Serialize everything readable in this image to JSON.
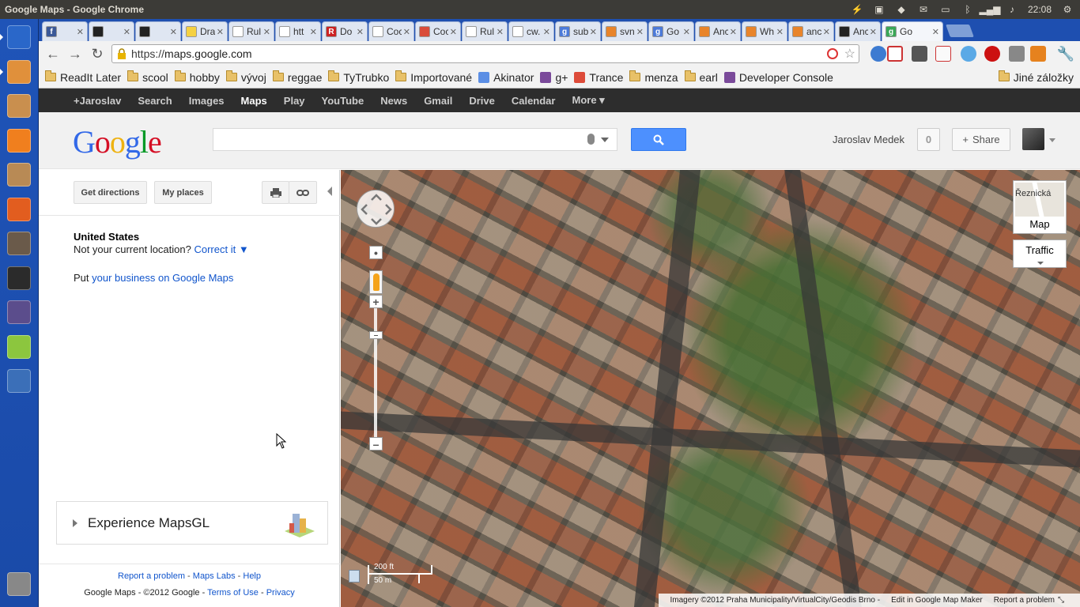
{
  "window": {
    "title": "Google Maps - Google Chrome",
    "clock": "22:08"
  },
  "tabs": [
    {
      "label": "",
      "color": "#3b5998",
      "glyph": "f"
    },
    {
      "label": "",
      "color": "#222222",
      "glyph": ""
    },
    {
      "label": "",
      "color": "#222222",
      "glyph": ""
    },
    {
      "label": "Dra",
      "color": "#f5d142",
      "glyph": ""
    },
    {
      "label": "Rul",
      "color": "#ffffff",
      "glyph": ""
    },
    {
      "label": "htt",
      "color": "#ffffff",
      "glyph": ""
    },
    {
      "label": "Do",
      "color": "#cc2222",
      "glyph": "R"
    },
    {
      "label": "Coc",
      "color": "#ffffff",
      "glyph": ""
    },
    {
      "label": "Coc",
      "color": "#d94c3a",
      "glyph": ""
    },
    {
      "label": "Rul",
      "color": "#ffffff",
      "glyph": ""
    },
    {
      "label": "cw.",
      "color": "#ffffff",
      "glyph": ""
    },
    {
      "label": "sub",
      "color": "#4c7ad9",
      "glyph": "g"
    },
    {
      "label": "svn",
      "color": "#e8842b",
      "glyph": ""
    },
    {
      "label": "Go",
      "color": "#4c7ad9",
      "glyph": "g"
    },
    {
      "label": "Anc",
      "color": "#e8842b",
      "glyph": ""
    },
    {
      "label": "Wh",
      "color": "#e8842b",
      "glyph": ""
    },
    {
      "label": "anc",
      "color": "#e8842b",
      "glyph": ""
    },
    {
      "label": "Anc",
      "color": "#222222",
      "glyph": ""
    },
    {
      "label": "Go",
      "color": "#3aa757",
      "glyph": "g"
    }
  ],
  "url": {
    "protocol": "https://",
    "host": "maps.google.com"
  },
  "bookmarks": [
    {
      "label": "ReadIt Later",
      "type": "folder"
    },
    {
      "label": "scool",
      "type": "folder"
    },
    {
      "label": "hobby",
      "type": "folder"
    },
    {
      "label": "vývoj",
      "type": "folder"
    },
    {
      "label": "reggae",
      "type": "folder"
    },
    {
      "label": "TyTrubko",
      "type": "folder"
    },
    {
      "label": "Importované",
      "type": "folder"
    },
    {
      "label": "Akinator",
      "type": "site"
    },
    {
      "label": "g+",
      "type": "site"
    },
    {
      "label": "Trance",
      "type": "site"
    },
    {
      "label": "menza",
      "type": "folder"
    },
    {
      "label": "earl",
      "type": "folder"
    },
    {
      "label": "Developer Console",
      "type": "site"
    }
  ],
  "other_bookmarks": "Jiné záložky",
  "gbar": [
    "+Jaroslav",
    "Search",
    "Images",
    "Maps",
    "Play",
    "YouTube",
    "News",
    "Gmail",
    "Drive",
    "Calendar",
    "More ▾"
  ],
  "gbar_current": "Maps",
  "logo": [
    "G",
    "o",
    "o",
    "g",
    "l",
    "e"
  ],
  "logo_colors": [
    "#3369e8",
    "#d50f25",
    "#eeb211",
    "#3369e8",
    "#009925",
    "#d50f25"
  ],
  "header": {
    "user": "Jaroslav Medek",
    "notifications": "0",
    "share": "Share"
  },
  "panel": {
    "get_directions": "Get directions",
    "my_places": "My places",
    "location_title": "United States",
    "not_current": "Not your current location?",
    "correct_it": "Correct it ▼",
    "put": "Put",
    "business_link": "your business on Google Maps",
    "mapsgl": "Experience MapsGL"
  },
  "footer": {
    "links": [
      "Report a problem",
      "Maps Labs",
      "Help"
    ],
    "copy": "Google Maps - ©2012 Google -",
    "terms": "Terms of Use",
    "privacy": "Privacy"
  },
  "map": {
    "thumb_label": "Map",
    "thumb_street": "Řeznická",
    "traffic": "Traffic",
    "scale_ft": "200 ft",
    "scale_m": "50 m",
    "attribution": "Imagery ©2012 Praha Municipality/VirtualCity/Geodis Brno -",
    "edit": "Edit in Google Map Maker",
    "report": "Report a problem"
  },
  "launcher_colors": [
    "#2a67c9",
    "#e0903b",
    "#c98f4e",
    "#f07f1e",
    "#b88a55",
    "#e25d1f",
    "#6a5a4a",
    "#2b2b2b",
    "#5b4d8c",
    "#8cc63e",
    "#3b6fb8",
    "#888888"
  ]
}
